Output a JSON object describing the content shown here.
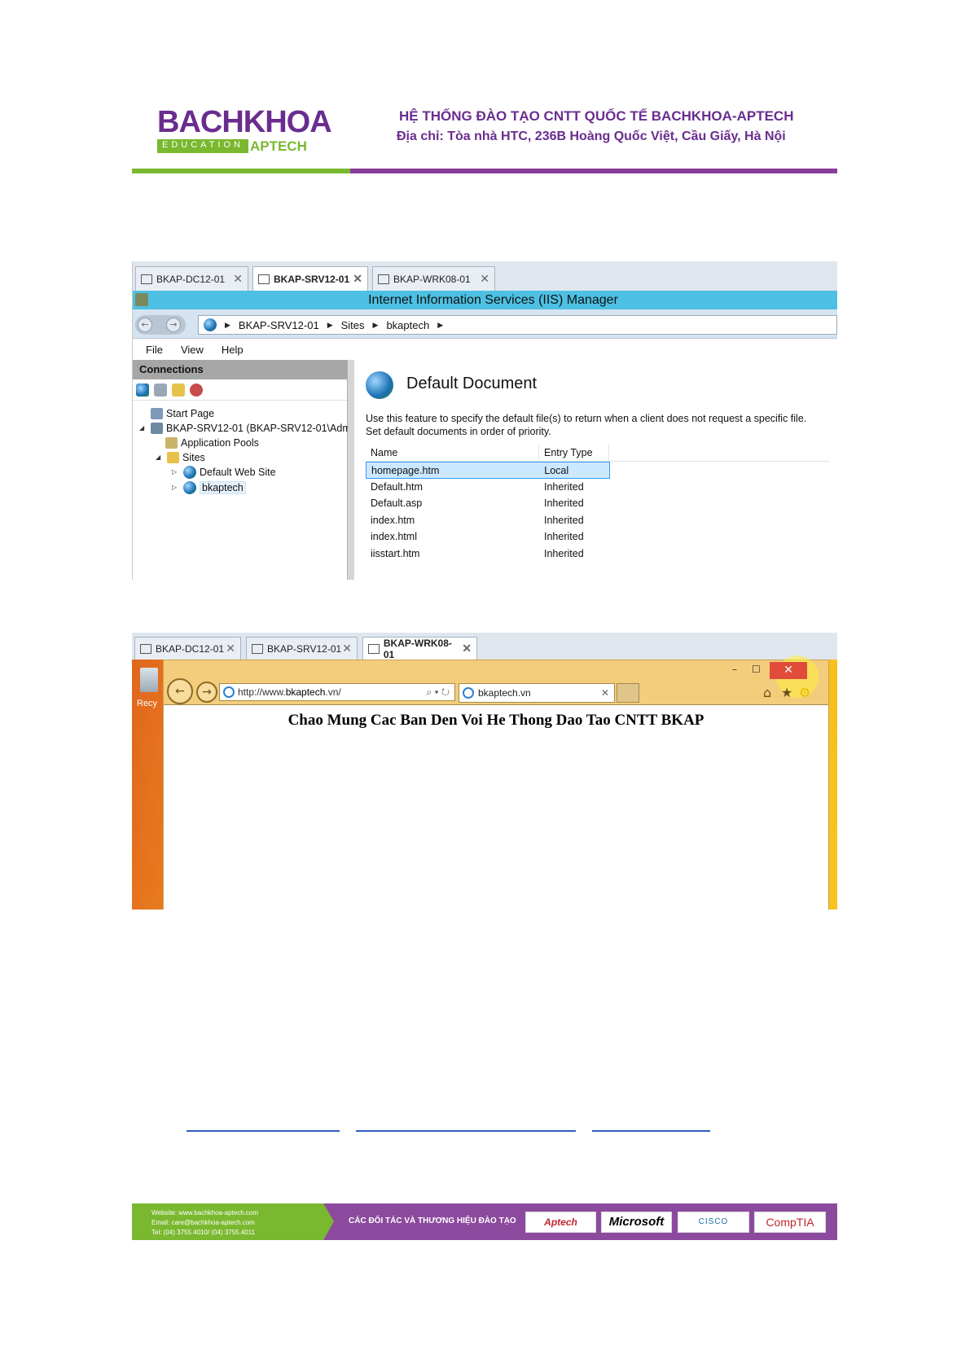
{
  "header": {
    "logo_main": "BACHKHOA",
    "logo_sub_edu": "EDUCATION",
    "logo_sub_aptech": "APTECH",
    "title": "HỆ THỐNG ĐÀO TẠO CNTT QUỐC TẾ BACHKHOA-APTECH",
    "address": "Địa chỉ: Tòa nhà HTC, 236B Hoàng Quốc Việt, Cầu Giấy, Hà Nội",
    "colors": {
      "purple": "#6a2d8f",
      "green": "#7ab82f"
    }
  },
  "shot1": {
    "vm_tabs": [
      "BKAP-DC12-01",
      "BKAP-SRV12-01",
      "BKAP-WRK08-01"
    ],
    "active_tab": 1,
    "window_title": "Internet Information Services (IIS) Manager",
    "breadcrumb": [
      "BKAP-SRV12-01",
      "Sites",
      "bkaptech"
    ],
    "menu": [
      "File",
      "View",
      "Help"
    ],
    "connections_label": "Connections",
    "tree": {
      "start_page": "Start Page",
      "server": "BKAP-SRV12-01 (BKAP-SRV12-01\\Adm",
      "app_pools": "Application Pools",
      "sites": "Sites",
      "default_site": "Default Web Site",
      "bkaptech": "bkaptech"
    },
    "feature_title": "Default Document",
    "description_1": "Use this feature to specify the default file(s) to return when a client does not request a specific file.",
    "description_2": "Set default documents in order of priority.",
    "columns": [
      "Name",
      "Entry Type"
    ],
    "rows": [
      {
        "name": "homepage.htm",
        "type": "Local"
      },
      {
        "name": "Default.htm",
        "type": "Inherited"
      },
      {
        "name": "Default.asp",
        "type": "Inherited"
      },
      {
        "name": "index.htm",
        "type": "Inherited"
      },
      {
        "name": "index.html",
        "type": "Inherited"
      },
      {
        "name": "iisstart.htm",
        "type": "Inherited"
      }
    ]
  },
  "shot2": {
    "vm_tabs": [
      "BKAP-DC12-01",
      "BKAP-SRV12-01",
      "BKAP-WRK08-01"
    ],
    "active_tab": 2,
    "recycle_label": "Recy",
    "url_prefix": "http://www.",
    "url_domain": "bkaptech",
    "url_suffix": ".vn/",
    "url_tools": "⌕ ▾ ↻",
    "tab_title": "bkaptech.vn",
    "page_heading": "Chao Mung Cac Ban Den Voi He Thong Dao Tao CNTT BKAP",
    "minimize": "–",
    "maximize": "☐",
    "close": "✕"
  },
  "footer": {
    "website": "Website: www.bachkhoa-aptech.com",
    "email": "Email: care@bachkhoa-aptech.com",
    "tel": "Tel: (04) 3755.4010/ (04) 3755.4011",
    "partners_label": "CÁC ĐỐI TÁC VÀ THƯƠNG HIỆU ĐÀO TẠO",
    "partners": [
      "Aptech",
      "Microsoft",
      "CISCO",
      "CompTIA"
    ]
  }
}
